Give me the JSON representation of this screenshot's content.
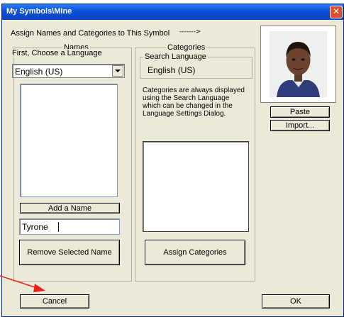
{
  "window": {
    "title": "My Symbols\\Mine",
    "close_glyph": "✕"
  },
  "header": {
    "assign_text": "Assign Names and Categories to This Symbol",
    "arrow_text": "------->"
  },
  "names": {
    "group_title": "Names",
    "choose_language_label": "First, Choose a Language",
    "language_selected": "English (US)",
    "add_name_button": "Add a Name",
    "name_input_value": "Tyrone",
    "remove_button": "Remove Selected Name"
  },
  "categories": {
    "group_title": "Categories",
    "search_language_title": "Search Language",
    "search_language_value": "English (US)",
    "info_text": "Categories are always displayed using the Search Language which can be changed in the Language Settings Dialog.",
    "assign_button": "Assign Categories"
  },
  "photo": {
    "paste_button": "Paste",
    "import_button": "Import..."
  },
  "footer": {
    "cancel_button": "Cancel",
    "ok_button": "OK"
  },
  "colors": {
    "annotation_arrow": "#e8231a",
    "title_bar": "#0b4fd6"
  }
}
